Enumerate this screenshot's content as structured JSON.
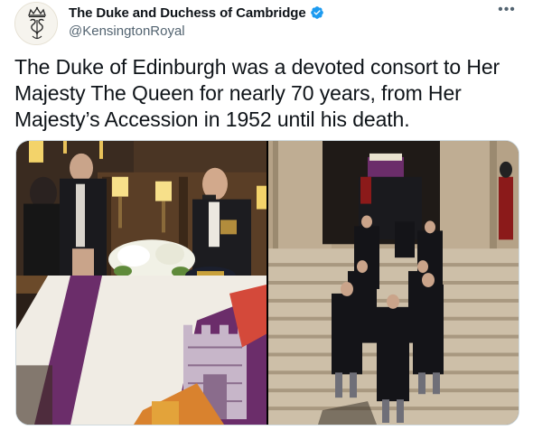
{
  "tweet": {
    "author": {
      "display_name": "The Duke and Duchess of Cambridge",
      "handle": "@KensingtonRoyal",
      "verified": true,
      "avatar_icon": "royal-cypher-icon"
    },
    "more_icon": "more-options-icon",
    "text": "The Duke of Edinburgh was a devoted consort to Her Majesty The Queen for nearly 70 years, from Her Majesty’s Accession in 1952 until his death.",
    "media": [
      {
        "icon": "photo-coffin-service"
      },
      {
        "icon": "photo-procession-steps"
      }
    ]
  },
  "colors": {
    "verified_blue": "#1d9bf0",
    "text_primary": "#0f1419",
    "text_secondary": "#536471",
    "border": "#cfd9de"
  }
}
